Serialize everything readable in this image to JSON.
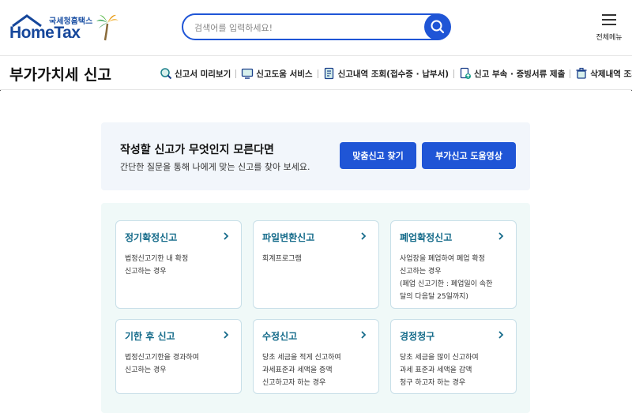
{
  "header": {
    "logo_small": "국세청홈택스",
    "logo_main": "HomeTax",
    "search_placeholder": "검색어를 입력하세요!",
    "menu_label": "전체메뉴"
  },
  "subheader": {
    "title": "부가가치세 신고",
    "nav": [
      {
        "label": "신고서 미리보기",
        "icon": "magnifier-doc-icon"
      },
      {
        "label": "신고도움 서비스",
        "icon": "monitor-icon"
      },
      {
        "label": "신고내역 조회(접수증 · 납부서)",
        "icon": "document-list-icon"
      },
      {
        "label": "신고 부속 · 증빙서류 제출",
        "icon": "upload-doc-icon"
      },
      {
        "label": "삭제내역 조회",
        "icon": "trash-icon"
      }
    ]
  },
  "help": {
    "title": "작성할 신고가 무엇인지 모른다면",
    "desc": "간단한 질문을 통해 나에게 맞는 신고를 찾아 보세요.",
    "btn_find": "맞춤신고 찾기",
    "btn_video": "부가신고 도움영상"
  },
  "cards": [
    {
      "title": "정기확정신고",
      "lines": [
        "법정신고기한 내 확정",
        "신고하는 경우"
      ]
    },
    {
      "title": "파일변환신고",
      "lines": [
        "회계프로그램"
      ]
    },
    {
      "title": "폐업확정신고",
      "lines": [
        "사업장을 폐업하여 폐업 확정",
        "신고하는 경우",
        "(폐업 신고기한 : 폐업일이 속한",
        "달의 다음달 25일까지)"
      ]
    },
    {
      "title": "기한 후 신고",
      "lines": [
        "법정신고기한을 경과하여",
        "신고하는 경우"
      ]
    },
    {
      "title": "수정신고",
      "lines": [
        "당초 세금을 적게 신고하여",
        "과세표준과 세액을 증액",
        "신고하고자 하는 경우"
      ]
    },
    {
      "title": "경정청구",
      "lines": [
        "당초 세금을 많이 신고하여",
        "과세 표준과 세액을 감액",
        "청구 하고자 하는 경우"
      ]
    }
  ],
  "colors": {
    "primary": "#1f55d6",
    "logo": "#16479b",
    "card_title": "#156b8a",
    "cards_bg": "#f0f9f8",
    "help_bg": "#f2f6fb"
  }
}
